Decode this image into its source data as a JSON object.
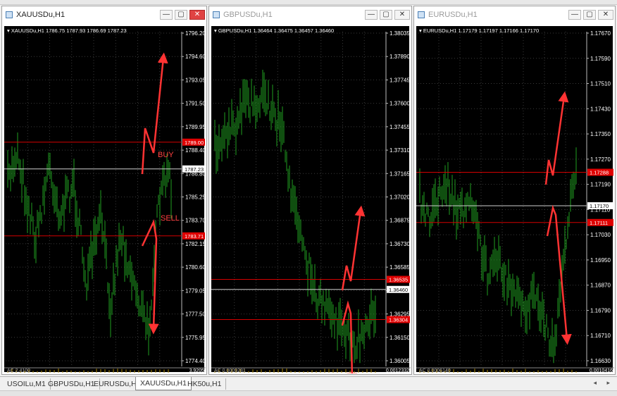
{
  "colors": {
    "chart_bg": "#000000",
    "candle": "#1f9e1f",
    "grid": "#3a3a3a",
    "axis_text": "#ffffff",
    "level_line": "#d40000",
    "level_tag": "#e00000",
    "arrow": "#ff3333",
    "annotation": "#ff4040"
  },
  "windows": [
    {
      "title": "XAUUSDu,H1",
      "state": "active",
      "ohlc": "XAUUSDu,H1  1786.75 1787.93 1786.69 1787.23",
      "y_labels": [
        "1796.20",
        "1794.60",
        "1793.05",
        "1791.50",
        "1789.95",
        "1788.40",
        "1786.80",
        "1785.25",
        "1783.70",
        "1782.15",
        "1780.60",
        "1779.05",
        "1777.50",
        "1775.95",
        "1774.40"
      ],
      "current_price": "1787.23",
      "level_tags": [
        "1789.00",
        "1783.71"
      ],
      "annotations": [
        "BUY",
        "SELL"
      ],
      "indicator": "AC 2.4100",
      "indicator_scale": "3.9205"
    },
    {
      "title": "GBPUSDu,H1",
      "state": "inactive",
      "ohlc": "GBPUSDu,H1  1.36464 1.36475 1.36457 1.36460",
      "y_labels": [
        "1.38035",
        "1.37890",
        "1.37745",
        "1.37600",
        "1.37455",
        "1.37310",
        "1.37165",
        "1.37020",
        "1.36875",
        "1.36730",
        "1.36585",
        "1.36440",
        "1.36295",
        "1.36150",
        "1.36005"
      ],
      "current_price": "1.36460",
      "level_tags": [
        "1.36535",
        "1.36304"
      ],
      "annotations": [],
      "indicator": "AC 0.0009281",
      "indicator_scale": "0.0012332"
    },
    {
      "title": "EURUSDu,H1",
      "state": "inactive",
      "ohlc": "EURUSDu,H1  1.17179 1.17197 1.17166 1.17170",
      "y_labels": [
        "1.17670",
        "1.17590",
        "1.17510",
        "1.17430",
        "1.17350",
        "1.17270",
        "1.17190",
        "1.17110",
        "1.17030",
        "1.16950",
        "1.16870",
        "1.16790",
        "1.16710",
        "1.16630"
      ],
      "current_price": "1.17170",
      "level_tags": [
        "1.17288",
        "1.17111"
      ],
      "annotations": [],
      "indicator": "AC 0.0006140",
      "indicator_scale": "0.0010416"
    }
  ],
  "titlebar_buttons": {
    "minimize": "—",
    "maximize": "▢",
    "close": "✕"
  },
  "tabs": [
    "USOILu,M1",
    "GBPUSDu,H1",
    "EURUSDu,H1",
    "XAUUSDu,H1",
    "HK50u,H1"
  ],
  "active_tab": "XAUUSDu,H1",
  "tab_scroll": "◂ ▸"
}
